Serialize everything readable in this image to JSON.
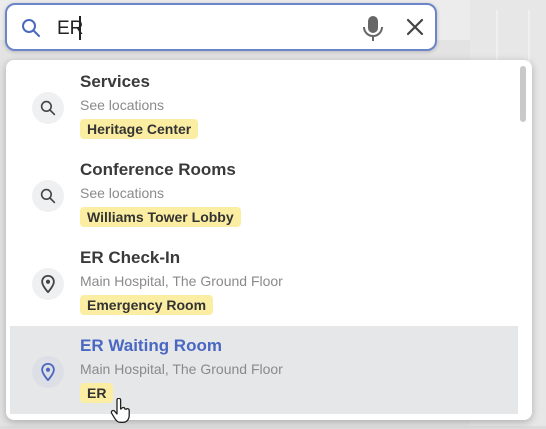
{
  "search": {
    "value": "ER",
    "icons": {
      "left": "search-icon",
      "mic": "microphone-icon",
      "clear": "close-icon"
    }
  },
  "results": [
    {
      "title": "Services",
      "subtitle": "See locations",
      "tag": "Heritage Center",
      "icon": "search-icon"
    },
    {
      "title": "Conference Rooms",
      "subtitle": "See locations",
      "tag": "Williams Tower Lobby",
      "icon": "search-icon"
    },
    {
      "title": "ER Check-In",
      "subtitle": "Main Hospital, The Ground Floor",
      "tag": "Emergency Room",
      "icon": "map-pin-icon"
    },
    {
      "title": "ER Waiting Room",
      "subtitle": "Main Hospital, The Ground Floor",
      "tag": "ER",
      "icon": "map-pin-icon",
      "selected": true
    }
  ],
  "colors": {
    "accent": "#4a67c2",
    "tag_bg": "#fbeea3",
    "selected_row_bg": "#e6e7e9",
    "search_border": "#6b85c9"
  }
}
